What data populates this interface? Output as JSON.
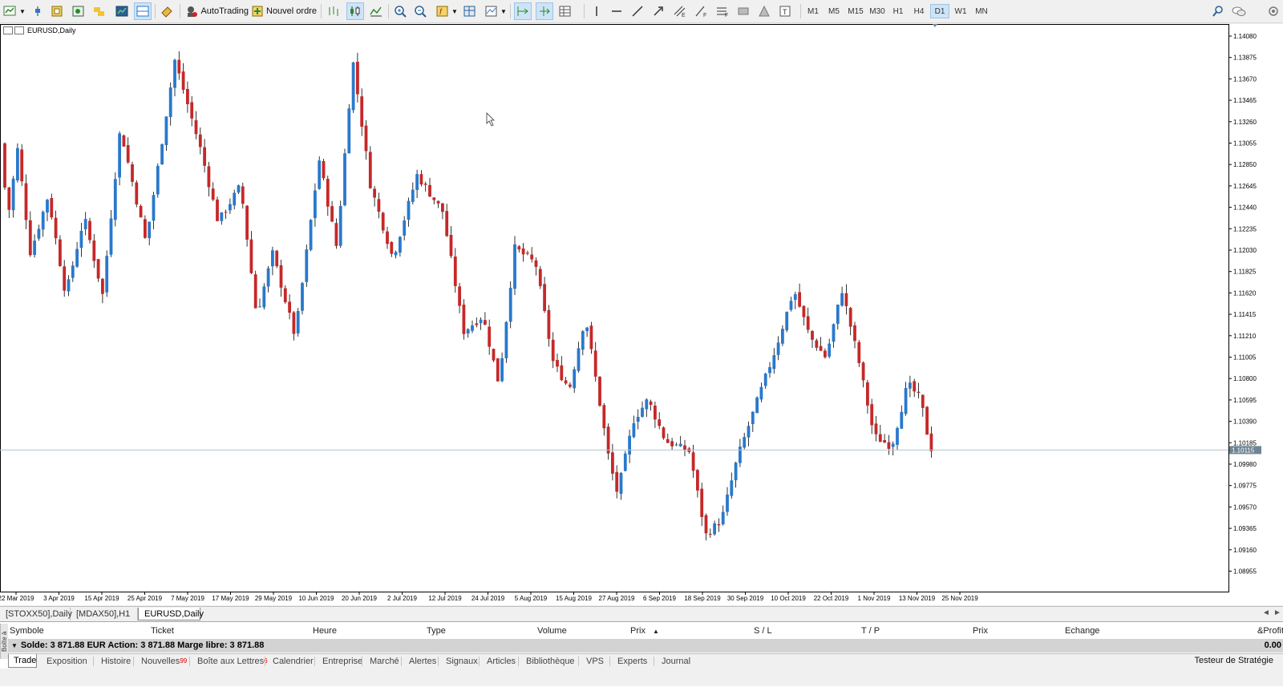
{
  "toolbar": {
    "autotrading_label": "AutoTrading",
    "new_order_label": "Nouvel ordre",
    "timeframes": [
      "M1",
      "M5",
      "M15",
      "M30",
      "H1",
      "H4",
      "D1",
      "W1",
      "MN"
    ],
    "active_timeframe": "D1"
  },
  "chart": {
    "title": "EURUSD,Daily",
    "price_labels": [
      "1.14080",
      "1.13875",
      "1.13670",
      "1.13465",
      "1.13260",
      "1.13055",
      "1.12850",
      "1.12645",
      "1.12440",
      "1.12235",
      "1.12030",
      "1.11825",
      "1.11620",
      "1.11415",
      "1.11210",
      "1.11005",
      "1.10800",
      "1.10595",
      "1.10390",
      "1.10185",
      "1.09980",
      "1.09775",
      "1.09570",
      "1.09365",
      "1.09160",
      "1.08955"
    ],
    "current_price": "1.10115",
    "date_labels": [
      "22 Mar 2019",
      "3 Apr 2019",
      "15 Apr 2019",
      "25 Apr 2019",
      "7 May 2019",
      "17 May 2019",
      "29 May 2019",
      "10 Jun 2019",
      "20 Jun 2019",
      "2 Jul 2019",
      "12 Jul 2019",
      "24 Jul 2019",
      "5 Aug 2019",
      "15 Aug 2019",
      "27 Aug 2019",
      "6 Sep 2019",
      "18 Sep 2019",
      "30 Sep 2019",
      "10 Oct 2019",
      "22 Oct 2019",
      "1 Nov 2019",
      "13 Nov 2019",
      "25 Nov 2019"
    ],
    "colors": {
      "bull": "#2979cc",
      "bear": "#c62828",
      "wick": "#000000",
      "price_line": "#b0c4d0",
      "current_price_bg": "#6e8594"
    }
  },
  "chart_tabs": [
    "[STOXX50],Daily",
    "[MDAX50],H1",
    "EURUSD,Daily"
  ],
  "active_chart_tab": "EURUSD,Daily",
  "terminal": {
    "side_label": "Boîte à outils",
    "columns": [
      "Symbole",
      "Ticket",
      "Heure",
      "Type",
      "Volume",
      "Prix",
      "S / L",
      "T / P",
      "Prix",
      "Echange",
      "&Profit"
    ],
    "sort_arrow": "▲",
    "balance_text": "Solde: 3 871.88 EUR  Action: 3 871.88  Marge libre: 3 871.88",
    "balance_value": "0.00",
    "tabs": [
      {
        "label": "Trade"
      },
      {
        "label": "Exposition"
      },
      {
        "label": "Histoire"
      },
      {
        "label": "Nouvelles",
        "badge": "99"
      },
      {
        "label": "Boîte aux Lettres",
        "badge": "6"
      },
      {
        "label": "Calendrier"
      },
      {
        "label": "Entreprise"
      },
      {
        "label": "Marché"
      },
      {
        "label": "Alertes"
      },
      {
        "label": "Signaux"
      },
      {
        "label": "Articles"
      },
      {
        "label": "Bibliothèque"
      },
      {
        "label": "VPS"
      },
      {
        "label": "Experts"
      },
      {
        "label": "Journal"
      }
    ],
    "active_tab": "Trade",
    "strategy_tester": "Testeur de Stratégie"
  }
}
